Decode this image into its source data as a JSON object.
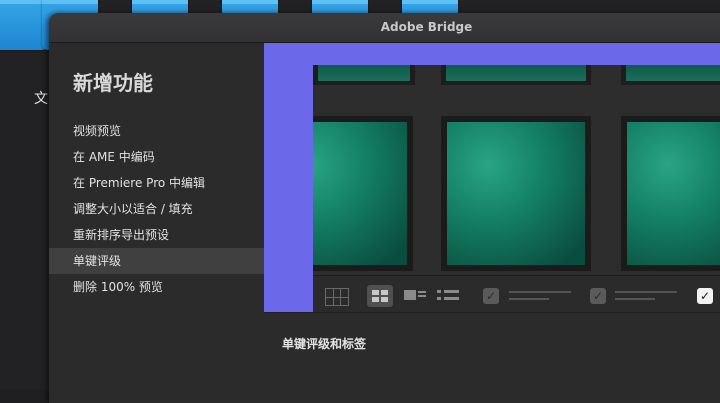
{
  "desktop": {
    "label_fragment": "文"
  },
  "window": {
    "title": "Adobe Bridge"
  },
  "sidebar": {
    "heading": "新增功能",
    "items": [
      {
        "label": "视频预览",
        "active": false
      },
      {
        "label": "在 AME 中编码",
        "active": false
      },
      {
        "label": "在 Premiere Pro 中编辑",
        "active": false
      },
      {
        "label": "调整大小以适合 / 填充",
        "active": false
      },
      {
        "label": "重新排序导出预设",
        "active": false
      },
      {
        "label": "单键评级",
        "active": true
      },
      {
        "label": "删除 100% 预览",
        "active": false
      }
    ]
  },
  "main": {
    "section_title": "单键评级和标签",
    "checkbox_glyph": "✓",
    "toolbar_icons": [
      "grid-view-icon",
      "thumbnail-grid-icon",
      "detail-view-icon",
      "list-view-icon",
      "checkbox-icon",
      "checkbox-icon",
      "checkbox-checked-icon"
    ]
  },
  "colors": {
    "accent_panel": "#6b68ea",
    "leaf_green": "#148066"
  }
}
